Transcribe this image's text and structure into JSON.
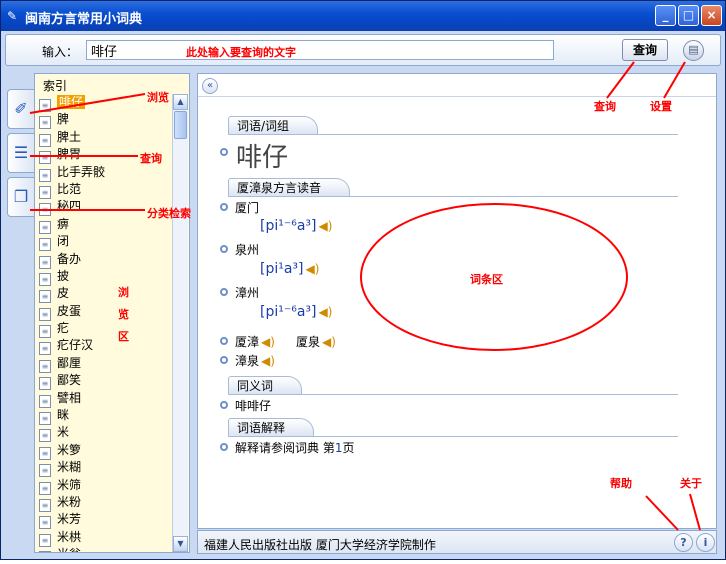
{
  "window": {
    "title": "闽南方言常用小词典",
    "controls": [
      "_",
      "□",
      "×"
    ]
  },
  "search": {
    "label": "输入：",
    "value": "啡仔",
    "button": "查询"
  },
  "index": {
    "header": "索引",
    "items": [
      "啡仔",
      "脾",
      "脾土",
      "脾胃",
      "比手弄骹",
      "比范",
      "秘四",
      "痹",
      "闭",
      "备办",
      "披",
      "皮",
      "皮蛋",
      "疕",
      "疕仔汉",
      "鄙厘",
      "鄙笑",
      "譬相",
      "眯",
      "米",
      "米箩",
      "米糊",
      "米筛",
      "米粉",
      "米芳",
      "米栱",
      "米瓮"
    ],
    "selected_index": 0
  },
  "entry": {
    "sections": {
      "word": "词语/词组",
      "reading": "厦漳泉方言读音",
      "synonym": "同义词",
      "explanation": "词语解释"
    },
    "headword": "啡仔",
    "readings": [
      {
        "city": "厦门",
        "pinyin": "[pi¹⁻⁶a³]"
      },
      {
        "city": "泉州",
        "pinyin": "[pi¹a³]"
      },
      {
        "city": "漳州",
        "pinyin": "[pi¹⁻⁶a³]"
      }
    ],
    "combined": [
      "厦漳",
      "厦泉",
      "漳泉"
    ],
    "synonym": "啡啡仔",
    "explanation_prefix": "解释请参阅词典 第",
    "explanation_page": "1",
    "explanation_suffix": "页"
  },
  "footer": {
    "text": "福建人民出版社出版   厦门大学经济学院制作"
  },
  "annotations": {
    "input_hint": "此处输入要查询的文字",
    "browse": "浏览",
    "query_side": "查询",
    "category": "分类检索",
    "browse_area": [
      "浏",
      "览",
      "区"
    ],
    "query": "查询",
    "settings": "设置",
    "entry_area": "词条区",
    "help": "帮助",
    "about": "关于"
  },
  "colors": {
    "annotation": "#ff0000",
    "selected": "#f0a000",
    "titlebar": "#0a4fd1",
    "index_bg": "#fffbdc"
  }
}
